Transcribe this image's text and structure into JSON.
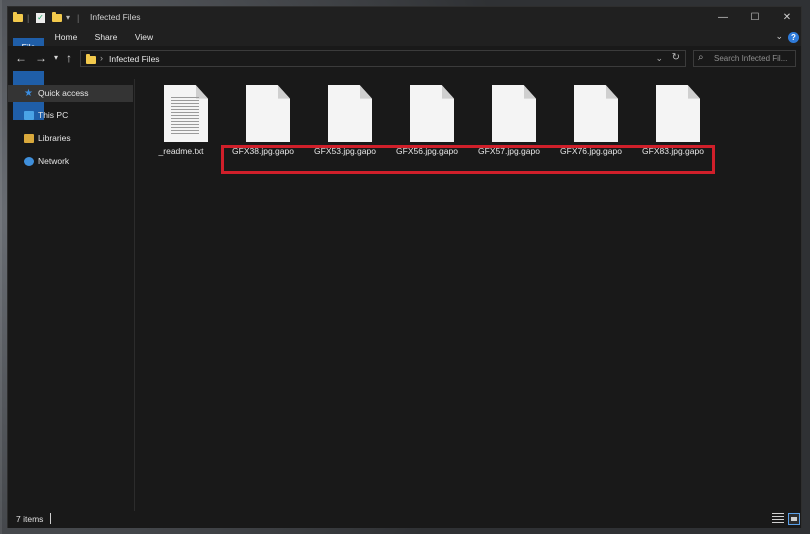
{
  "window": {
    "title": "Infected Files"
  },
  "ribbon": {
    "tabs": [
      "File",
      "Home",
      "Share",
      "View"
    ]
  },
  "address": {
    "path": "Infected Files"
  },
  "search": {
    "placeholder": "Search Infected Fil..."
  },
  "sidebar": {
    "items": [
      {
        "label": "Quick access",
        "icon": "star-icon",
        "selected": true
      },
      {
        "label": "This PC",
        "icon": "computer-icon"
      },
      {
        "label": "Libraries",
        "icon": "libraries-icon"
      },
      {
        "label": "Network",
        "icon": "network-icon"
      }
    ]
  },
  "files": [
    {
      "name": "_readme.txt",
      "icon": "text-file-icon"
    },
    {
      "name": "GFX38.jpg.gapo",
      "icon": "blank-file-icon"
    },
    {
      "name": "GFX53.jpg.gapo",
      "icon": "blank-file-icon"
    },
    {
      "name": "GFX56.jpg.gapo",
      "icon": "blank-file-icon"
    },
    {
      "name": "GFX57.jpg.gapo",
      "icon": "blank-file-icon"
    },
    {
      "name": "GFX76.jpg.gapo",
      "icon": "blank-file-icon"
    },
    {
      "name": "GFX83.jpg.gapo",
      "icon": "blank-file-icon"
    }
  ],
  "status": {
    "item_count": "7 items"
  },
  "colors": {
    "accent": "#1f5ea8",
    "highlight_box": "#d01f2a",
    "background": "#191919"
  }
}
